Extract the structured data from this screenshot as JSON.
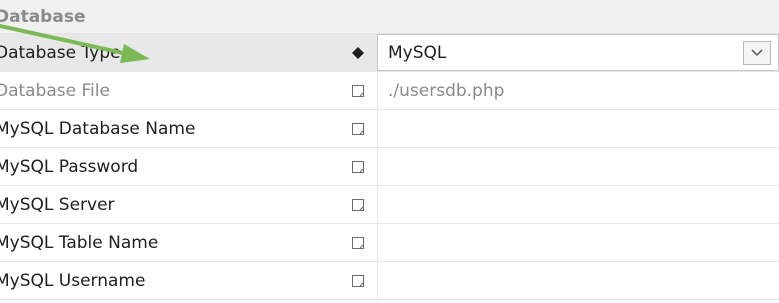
{
  "section": {
    "label": "Database"
  },
  "rows": [
    {
      "name": "Database Type",
      "value": "MySQL",
      "icon": "diamond-icon"
    },
    {
      "name": "Database File",
      "value": "./usersdb.php",
      "icon": "edit-box-icon"
    },
    {
      "name": "MySQL Database Name",
      "value": "",
      "icon": "edit-box-icon"
    },
    {
      "name": "MySQL Password",
      "value": "",
      "icon": "edit-box-icon"
    },
    {
      "name": "MySQL Server",
      "value": "",
      "icon": "edit-box-icon"
    },
    {
      "name": "MySQL Table Name",
      "value": "",
      "icon": "edit-box-icon"
    },
    {
      "name": "MySQL Username",
      "value": "",
      "icon": "edit-box-icon"
    }
  ],
  "colors": {
    "annotation_arrow": "#7bb956",
    "selected_row": "#e8e8e8"
  }
}
